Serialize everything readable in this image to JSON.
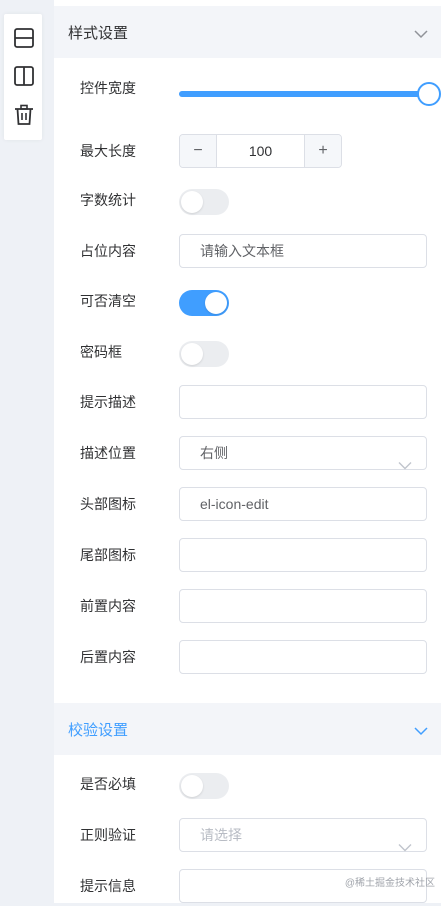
{
  "toolbar": {
    "icons": [
      "row-layout-icon",
      "column-layout-icon",
      "trash-icon"
    ]
  },
  "style_section": {
    "title": "样式设置",
    "width_label": "控件宽度",
    "width_value_percent": 100,
    "maxlength_label": "最大长度",
    "maxlength_value": "100",
    "minus": "−",
    "plus": "+",
    "wordcount_label": "字数统计",
    "wordcount_on": false,
    "placeholder_label": "占位内容",
    "placeholder_value": "请输入文本框",
    "clearable_label": "可否清空",
    "clearable_on": true,
    "password_label": "密码框",
    "password_on": false,
    "hint_label": "提示描述",
    "hint_value": "",
    "hint_pos_label": "描述位置",
    "hint_pos_value": "右侧",
    "prefix_icon_label": "头部图标",
    "prefix_icon_value": "el-icon-edit",
    "suffix_icon_label": "尾部图标",
    "suffix_icon_value": "",
    "prepend_label": "前置内容",
    "prepend_value": "",
    "append_label": "后置内容",
    "append_value": ""
  },
  "validate_section": {
    "title": "校验设置",
    "required_label": "是否必填",
    "required_on": false,
    "regex_label": "正则验证",
    "regex_placeholder": "请选择",
    "message_label": "提示信息",
    "message_value": ""
  },
  "watermark": "@稀土掘金技术社区",
  "colors": {
    "accent": "#409eff",
    "border": "#dcdfe6",
    "header_bg": "#f3f5f9"
  }
}
